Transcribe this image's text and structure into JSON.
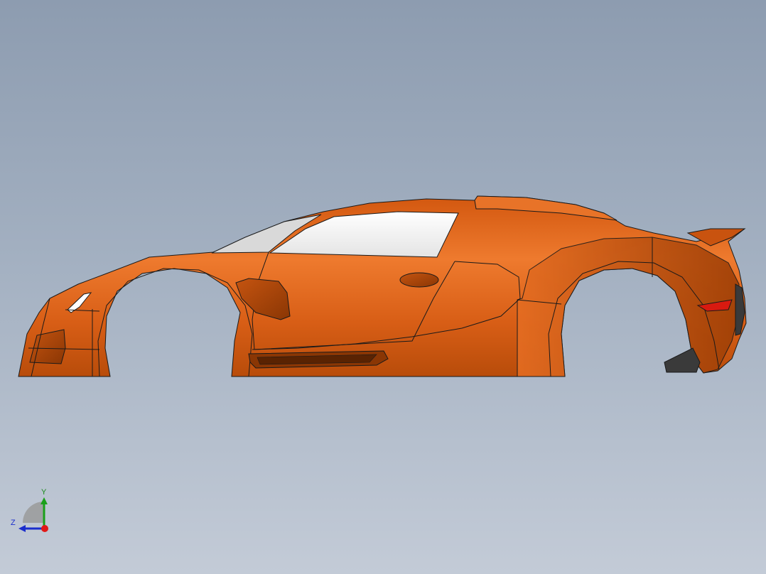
{
  "viewport": {
    "background_top": "#8d9cb0",
    "background_bottom": "#c3cbd7"
  },
  "model": {
    "body_color": "#e0651c",
    "body_shadow": "#a84608",
    "glass_color": "#f2f2f2",
    "taillight_color": "#d81a10",
    "grille_color": "#3a3a3a"
  },
  "triad": {
    "y_label": "Y",
    "z_label": "Z",
    "x_color": "#e01818",
    "y_color": "#1aa01a",
    "z_color": "#1a2dcc"
  }
}
